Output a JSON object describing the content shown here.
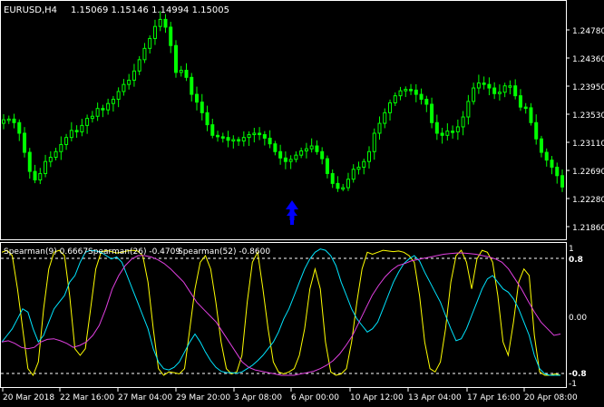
{
  "main_panel": {
    "title": "EURUSD,H4",
    "ohlc": "1.15069 1.15146 1.14994 1.15005",
    "price_labels": [
      "1.24780",
      "1.24360",
      "1.23950",
      "1.23530",
      "1.23110",
      "1.22690",
      "1.22280",
      "1.21860"
    ],
    "colors": {
      "bars": "#00ff00",
      "arrow": "#0000ff",
      "background": "#000000",
      "frame": "#ffffff"
    },
    "arrow_icon": "up-arrow-icon"
  },
  "indicator_panel": {
    "title_s9": "Spearman(9) 0.6667",
    "title_s26": "Spearman(26) -0.4709",
    "title_s52": "Spearman(52) -0.8600",
    "levels_major": [
      "0.8",
      "0.00",
      "-0.8"
    ],
    "levels_minor": [
      "1",
      "-1"
    ],
    "colors": {
      "spearman9": "#ffff00",
      "spearman26": "#00e5ff",
      "spearman52": "#e040e0",
      "level_line": "#ffffff"
    }
  },
  "time_axis": [
    "20 Mar 2018",
    "22 Mar 16:00",
    "27 Mar 04:00",
    "29 Mar 20:00",
    "3 Apr 08:00",
    "6 Apr 00:00",
    "10 Apr 12:00",
    "13 Apr 04:00",
    "17 Apr 16:00",
    "20 Apr 08:00"
  ],
  "chart_data": [
    {
      "type": "candlestick",
      "title": "EURUSD,H4",
      "ylim": [
        1.2166,
        1.2498
      ],
      "values": [
        1.2335,
        1.2336,
        1.2331,
        1.2316,
        1.2289,
        1.2262,
        1.225,
        1.2259,
        1.2276,
        1.2282,
        1.229,
        1.23,
        1.231,
        1.232,
        1.2318,
        1.2327,
        1.2337,
        1.234,
        1.2351,
        1.2349,
        1.2358,
        1.2364,
        1.2375,
        1.2385,
        1.2391,
        1.2404,
        1.242,
        1.2436,
        1.245,
        1.2467,
        1.2477,
        1.2466,
        1.244,
        1.2402,
        1.2405,
        1.2395,
        1.2371,
        1.236,
        1.2345,
        1.2328,
        1.2313,
        1.2311,
        1.231,
        1.2306,
        1.2307,
        1.2305,
        1.231,
        1.2314,
        1.2316,
        1.2314,
        1.2309,
        1.2301,
        1.229,
        1.2281,
        1.2276,
        1.2279,
        1.2285,
        1.2291,
        1.2294,
        1.2298,
        1.229,
        1.228,
        1.2259,
        1.2245,
        1.2238,
        1.2239,
        1.2251,
        1.2265,
        1.2268,
        1.2276,
        1.229,
        1.2316,
        1.233,
        1.2345,
        1.2359,
        1.2369,
        1.2376,
        1.2378,
        1.2377,
        1.2371,
        1.2364,
        1.2357,
        1.2331,
        1.2316,
        1.2313,
        1.2319,
        1.2318,
        1.2325,
        1.2339,
        1.2361,
        1.238,
        1.2387,
        1.2385,
        1.238,
        1.2372,
        1.2374,
        1.2383,
        1.2383,
        1.2369,
        1.2353,
        1.2352,
        1.2331,
        1.2308,
        1.2289,
        1.2278,
        1.2268,
        1.2256,
        1.224
      ]
    },
    {
      "type": "line",
      "title": "Spearman",
      "ylim": [
        -1.05,
        1.05
      ],
      "series": [
        {
          "name": "Spearman(9)",
          "values": [
            0.95,
            0.98,
            0.9,
            0.4,
            -0.2,
            -0.8,
            -0.9,
            -0.7,
            0.1,
            0.7,
            0.95,
            0.98,
            0.9,
            0.3,
            -0.5,
            -0.6,
            -0.5,
            0.1,
            0.7,
            0.95,
            0.98,
            0.96,
            0.94,
            0.95,
            0.97,
            0.98,
            0.97,
            0.9,
            0.5,
            -0.2,
            -0.8,
            -0.9,
            -0.85,
            -0.86,
            -0.88,
            -0.8,
            -0.2,
            0.4,
            0.8,
            0.9,
            0.7,
            0.2,
            -0.4,
            -0.8,
            -0.88,
            -0.85,
            -0.6,
            0.2,
            0.8,
            0.95,
            0.4,
            -0.2,
            -0.7,
            -0.85,
            -0.88,
            -0.85,
            -0.8,
            -0.6,
            -0.2,
            0.4,
            0.7,
            0.4,
            -0.4,
            -0.85,
            -0.9,
            -0.88,
            -0.8,
            -0.4,
            0.2,
            0.7,
            0.95,
            0.92,
            0.95,
            0.98,
            0.97,
            0.96,
            0.97,
            0.95,
            0.9,
            0.8,
            0.3,
            -0.4,
            -0.8,
            -0.85,
            -0.7,
            -0.2,
            0.5,
            0.9,
            0.98,
            0.8,
            0.4,
            0.85,
            0.98,
            0.95,
            0.8,
            0.3,
            -0.4,
            -0.6,
            -0.1,
            0.5,
            0.7,
            0.6,
            -0.3,
            -0.85,
            -0.9,
            -0.9,
            -0.88,
            -0.9
          ]
        },
        {
          "name": "Spearman(26)",
          "values": [
            -0.4,
            -0.3,
            -0.2,
            -0.05,
            0.1,
            0.05,
            -0.2,
            -0.4,
            -0.3,
            -0.1,
            0.1,
            0.2,
            0.3,
            0.5,
            0.6,
            0.8,
            0.95,
            0.98,
            0.97,
            0.95,
            0.9,
            0.85,
            0.88,
            0.8,
            0.6,
            0.4,
            0.2,
            0.0,
            -0.2,
            -0.5,
            -0.7,
            -0.8,
            -0.82,
            -0.78,
            -0.7,
            -0.55,
            -0.4,
            -0.28,
            -0.4,
            -0.55,
            -0.68,
            -0.78,
            -0.84,
            -0.86,
            -0.86,
            -0.87,
            -0.85,
            -0.8,
            -0.75,
            -0.68,
            -0.6,
            -0.5,
            -0.4,
            -0.25,
            -0.05,
            0.1,
            0.3,
            0.5,
            0.7,
            0.85,
            0.95,
            1.0,
            0.98,
            0.9,
            0.75,
            0.5,
            0.3,
            0.1,
            -0.05,
            -0.15,
            -0.25,
            -0.2,
            -0.1,
            0.1,
            0.3,
            0.5,
            0.65,
            0.78,
            0.85,
            0.9,
            0.82,
            0.65,
            0.5,
            0.35,
            0.2,
            0.0,
            -0.2,
            -0.38,
            -0.35,
            -0.2,
            0.0,
            0.2,
            0.4,
            0.55,
            0.6,
            0.5,
            0.4,
            0.35,
            0.25,
            0.1,
            -0.1,
            -0.3,
            -0.6,
            -0.8,
            -0.88,
            -0.9,
            -0.9,
            -0.9
          ]
        },
        {
          "name": "Spearman(52)",
          "values": [
            -0.4,
            -0.38,
            -0.42,
            -0.48,
            -0.5,
            -0.48,
            -0.4,
            -0.36,
            -0.35,
            -0.38,
            -0.42,
            -0.48,
            -0.45,
            -0.4,
            -0.3,
            -0.15,
            0.1,
            0.4,
            0.6,
            0.75,
            0.85,
            0.9,
            0.9,
            0.88,
            0.84,
            0.78,
            0.7,
            0.6,
            0.5,
            0.35,
            0.2,
            0.1,
            0.0,
            -0.1,
            -0.25,
            -0.4,
            -0.55,
            -0.7,
            -0.78,
            -0.82,
            -0.84,
            -0.86,
            -0.88,
            -0.9,
            -0.9,
            -0.9,
            -0.88,
            -0.86,
            -0.84,
            -0.8,
            -0.75,
            -0.68,
            -0.58,
            -0.45,
            -0.3,
            -0.1,
            0.1,
            0.3,
            0.45,
            0.58,
            0.68,
            0.75,
            0.78,
            0.82,
            0.84,
            0.86,
            0.88,
            0.9,
            0.92,
            0.93,
            0.94,
            0.94,
            0.93,
            0.92,
            0.9,
            0.88,
            0.85,
            0.8,
            0.7,
            0.55,
            0.4,
            0.22,
            0.05,
            -0.1,
            -0.2,
            -0.3,
            -0.28
          ]
        }
      ]
    }
  ]
}
